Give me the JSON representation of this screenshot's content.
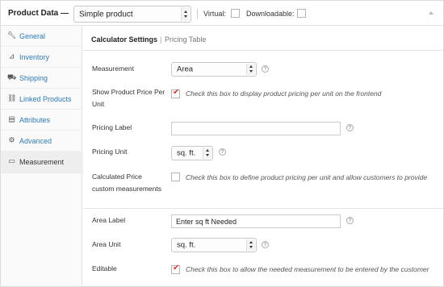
{
  "header": {
    "title": "Product Data —",
    "product_type": "Simple product",
    "virtual_label": "Virtual:",
    "downloadable_label": "Downloadable:"
  },
  "sidebar": {
    "items": [
      {
        "label": "General",
        "icon": "wrench-icon"
      },
      {
        "label": "Inventory",
        "icon": "chart-icon"
      },
      {
        "label": "Shipping",
        "icon": "truck-icon"
      },
      {
        "label": "Linked Products",
        "icon": "link-icon"
      },
      {
        "label": "Attributes",
        "icon": "list-icon"
      },
      {
        "label": "Advanced",
        "icon": "gear-icon"
      },
      {
        "label": "Measurement",
        "icon": "ruler-icon",
        "active": true
      }
    ]
  },
  "subtabs": {
    "active": "Calculator Settings",
    "separator": "|",
    "other": "Pricing Table"
  },
  "fields": {
    "measurement": {
      "label": "Measurement",
      "value": "Area"
    },
    "show_price": {
      "label_line1": "Show Product Price Per",
      "label_line2": "Unit",
      "checked": true,
      "desc": "Check this box to display product pricing per unit on the frontend"
    },
    "pricing_label": {
      "label": "Pricing Label",
      "value": ""
    },
    "pricing_unit": {
      "label": "Pricing Unit",
      "value": "sq. ft."
    },
    "calculated_price": {
      "label_line1": "Calculated Price",
      "label_line2": "custom measurements",
      "checked": false,
      "desc": "Check this box to define product pricing per unit and allow customers to provide"
    },
    "area_label": {
      "label": "Area Label",
      "value": "Enter sq ft Needed"
    },
    "area_unit": {
      "label": "Area Unit",
      "value": "sq. ft."
    },
    "editable": {
      "label": "Editable",
      "checked": true,
      "desc": "Check this box to allow the needed measurement to be entered by the customer"
    }
  },
  "help_glyph": "?"
}
